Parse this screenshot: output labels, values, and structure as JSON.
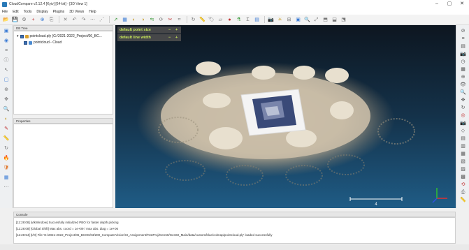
{
  "window": {
    "title": "CloudCompare v2.12.4 [Kyiv] [64-bit] - [3D View 1]",
    "min": "–",
    "max": "▢",
    "close": "✕"
  },
  "menu": [
    "File",
    "Edit",
    "Tools",
    "Display",
    "Plugins",
    "3D Views",
    "Help"
  ],
  "db_tree": {
    "title": "DB Tree",
    "root_label": "pointcloud.ply (G:/2021-2022_Project/06_BC...",
    "child_label": "pointcloud - Cloud"
  },
  "properties": {
    "title": "Properties"
  },
  "overlay": {
    "msg1": "default point size",
    "msg2": "default line width",
    "minus": "−",
    "plus": "+"
  },
  "scale_label": "4",
  "console": {
    "title": "Console",
    "lines": [
      "[11:28:08] [vtkWindow] Succesfully initialized PBO for faster depth picking",
      "[11:28:08] [Global Shift] Max abs. coord = 1e+09 / max abs. diag = 1e+06",
      "[11:28:54] [I/O] File 'G:/2021-2022_Project/06_BC0G/03/200_ComputerVision/SI_Assignment/TestProj/Gen60/Gen60_Main/data/custom/blue/colmap/pointcloud.ply' loaded successfully"
    ]
  },
  "colors": {
    "viewport_top": "#0d1620",
    "viewport_bottom": "#1f5c86",
    "overlay_text": "#c8e85a",
    "axis_x": "#e03030",
    "axis_y": "#30c030",
    "axis_z": "#3050e0"
  },
  "icons": {
    "toolbar": [
      "open-icon",
      "save-icon",
      "settings-icon",
      "add-icon",
      "merge-icon",
      "clone-icon",
      "delete-icon",
      "undo-icon",
      "redo-icon",
      "sample-icon",
      "subsample-icon",
      "normal-icon",
      "octree-icon",
      "color-icon",
      "scalar-icon",
      "distance-icon",
      "register-icon",
      "segment-icon",
      "crop-icon",
      "rotate-icon",
      "measure-icon",
      "label-icon",
      "plane-icon",
      "sphere-icon",
      "filter-icon",
      "stats-icon",
      "histogram-icon",
      "camera-icon",
      "light-icon",
      "grid-icon",
      "screen-icon",
      "zoom-icon",
      "fit-icon",
      "view-top-icon",
      "view-front-icon",
      "view-iso-icon"
    ],
    "left": [
      "db-icon",
      "globe-icon",
      "layers-icon",
      "info-icon",
      "arrow-icon",
      "select-icon",
      "pivot-icon",
      "move-icon",
      "search-icon",
      "color-wheel-icon",
      "paint-icon",
      "measure-left-icon",
      "rotate-left-icon",
      "fire-icon",
      "shield-icon",
      "cube-icon",
      "more-icon"
    ],
    "right": [
      "info-circle-icon",
      "list-icon",
      "book-icon",
      "camera-icon",
      "clock-icon",
      "grid-right-icon",
      "compass-icon",
      "eye-icon",
      "zoom-right-icon",
      "pan-icon",
      "rotate-right-icon",
      "target-icon",
      "camera-right-icon",
      "projection-icon",
      "view1-icon",
      "view2-icon",
      "view3-icon",
      "view4-icon",
      "view5-icon",
      "view6-icon",
      "reset-icon",
      "screenshot-icon",
      "ruler-icon"
    ]
  }
}
